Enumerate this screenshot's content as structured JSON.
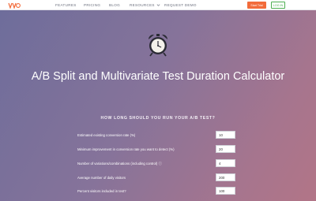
{
  "nav": {
    "links": [
      "FEATURES",
      "PRICING",
      "BLOG",
      "RESOURCES",
      "REQUEST DEMO"
    ],
    "trial_button": "Start Trial",
    "login_button": "LOG IN"
  },
  "hero": {
    "icon": "alarm-clock-icon",
    "title": "A/B Split and Multivariate Test Duration Calculator",
    "subtitle": "HOW LONG SHOULD YOU RUN YOUR A/B TEST?"
  },
  "form": {
    "fields": [
      {
        "label": "Estimated existing conversion rate (%)",
        "value": "10"
      },
      {
        "label": "Minimum improvement in conversion rate you want to detect (%)",
        "value": "20"
      },
      {
        "label": "Number of variations/combinations (including control) ⓘ",
        "value": "4"
      },
      {
        "label": "Average number of daily visitors",
        "value": "200"
      },
      {
        "label": "Percent visitors included in test?",
        "value": "100"
      }
    ]
  },
  "colors": {
    "accent_orange": "#f26b3a",
    "login_green": "#4caf50",
    "gradient_start": "#6e6d9b",
    "gradient_end": "#b27587"
  }
}
